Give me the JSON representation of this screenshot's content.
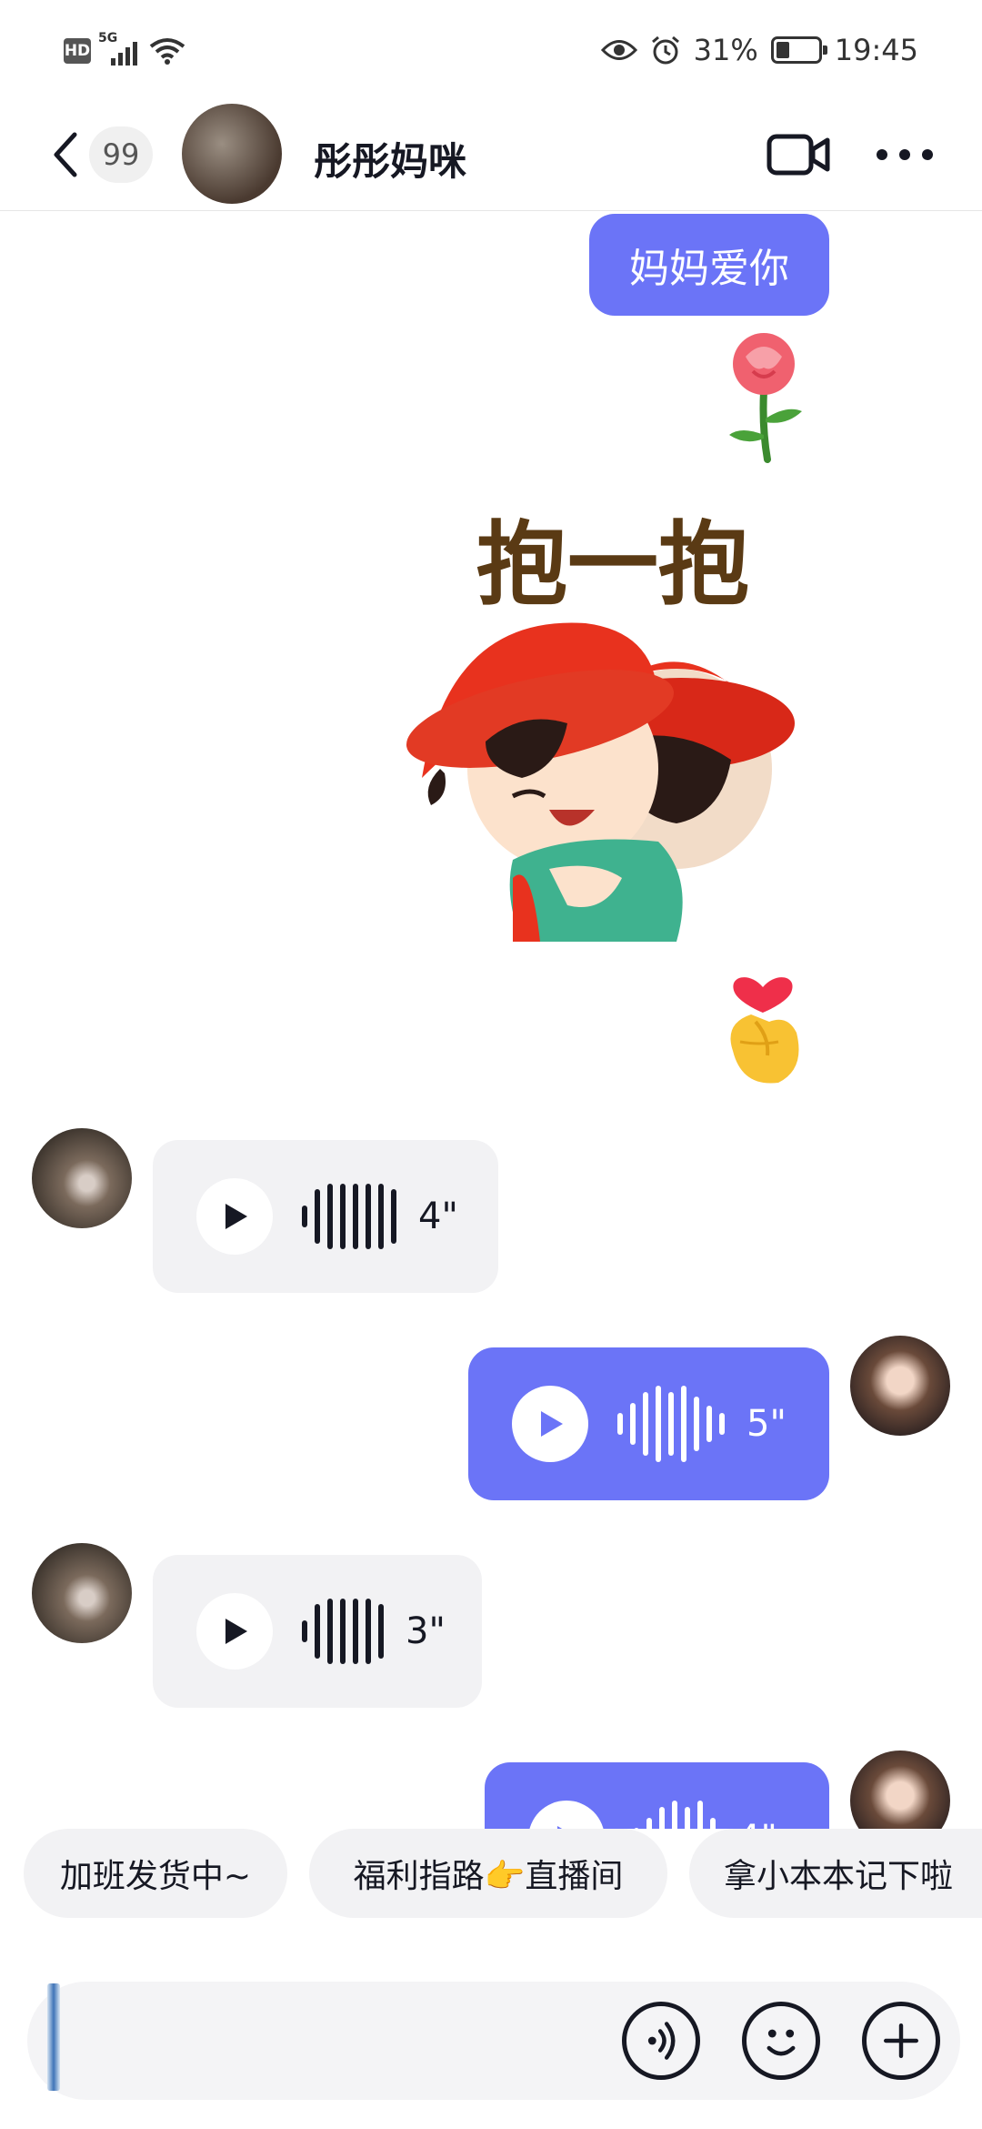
{
  "status_bar": {
    "hd": "HD",
    "network": "5G",
    "battery": "31%",
    "battery_level": 0.31,
    "time": "19:45"
  },
  "header": {
    "unread_count": "99",
    "contact_name": "彤彤妈咪"
  },
  "messages": {
    "text_message": "妈妈爱你",
    "voice": [
      {
        "sender": "other",
        "duration": "4\""
      },
      {
        "sender": "me",
        "duration": "5\""
      },
      {
        "sender": "other",
        "duration": "3\""
      },
      {
        "sender": "me",
        "duration": "4\""
      }
    ],
    "sticker_text": "抱一抱"
  },
  "quick_replies": [
    "加班发货中~",
    "福利指路👉直播间",
    "拿小本本记下啦"
  ],
  "colors": {
    "accent": "#6b74f7",
    "incoming_bubble": "#f2f2f4",
    "text": "#161823"
  },
  "icons": {
    "back": "back-icon",
    "video": "video-call-icon",
    "more": "more-icon",
    "voice_input": "voice-input-icon",
    "emoji": "emoji-icon",
    "plus": "plus-icon"
  }
}
